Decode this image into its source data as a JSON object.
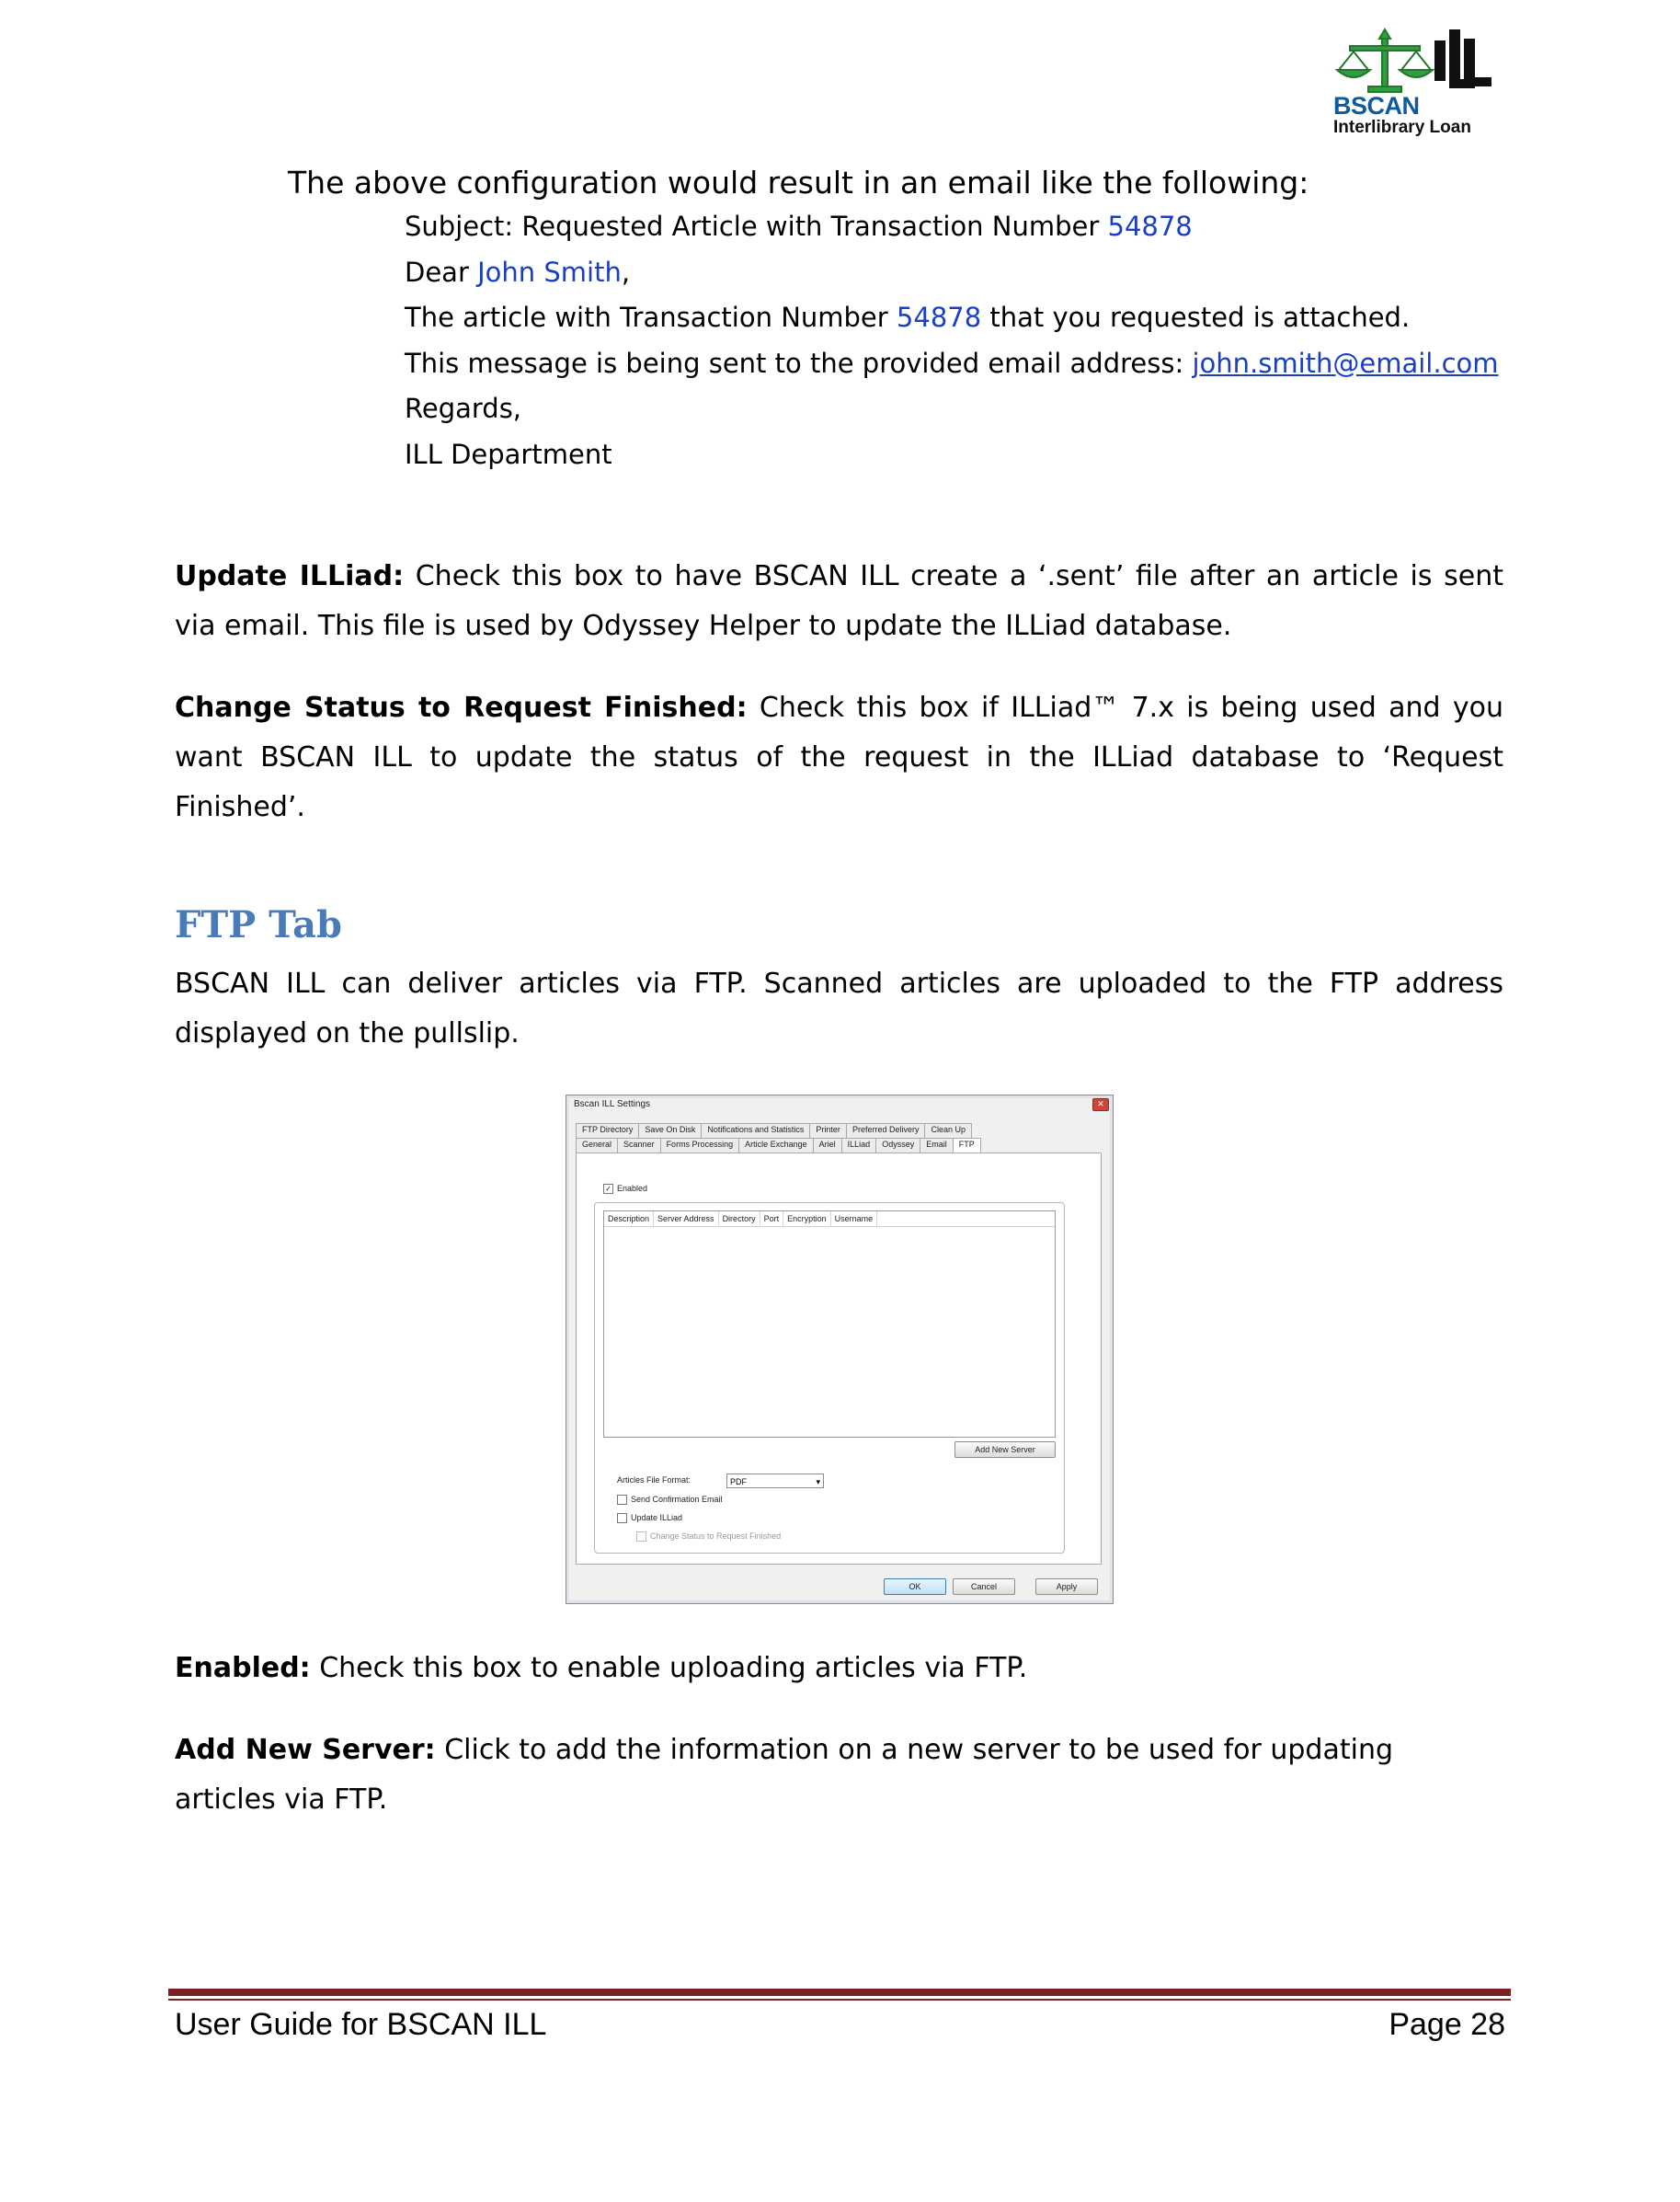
{
  "logo": {
    "name": "BSCAN",
    "subtitle": "Interlibrary Loan"
  },
  "email_example": {
    "intro": "The above configuration would result in an email like the following:",
    "subject_prefix": "Subject: Requested Article with Transaction Number ",
    "transaction_number": "54878",
    "dear_prefix": "Dear ",
    "name": "John Smith",
    "dear_suffix": ",",
    "article_prefix": "The article with Transaction Number ",
    "article_suffix": " that you requested is attached.",
    "message_prefix": "This message is being sent to the provided email address: ",
    "email": "john.smith@email.com",
    "regards": "Regards,",
    "department": "ILL Department"
  },
  "update_illiad": {
    "label": "Update ILLiad:",
    "text": "  Check this box to have BSCAN ILL create a ‘.sent’ file after an article is sent via email.  This file is used by Odyssey Helper to update the ILLiad database."
  },
  "change_status": {
    "label": "Change Status to Request Finished:",
    "text": "  Check this box if ILLiad™ 7.x is being used and you want BSCAN ILL to update the status of the request in the ILLiad database to ‘Request Finished’."
  },
  "ftp_tab": {
    "heading": "FTP Tab",
    "intro": "BSCAN ILL can deliver articles via FTP.  Scanned articles are uploaded to the FTP address displayed on the pullslip."
  },
  "dialog": {
    "title": "Bscan ILL Settings",
    "tabs_row1": [
      "FTP Directory",
      "Save On Disk",
      "Notifications and Statistics",
      "Printer",
      "Preferred Delivery",
      "Clean Up"
    ],
    "tabs_row2": [
      "General",
      "Scanner",
      "Forms Processing",
      "Article Exchange",
      "Ariel",
      "ILLiad",
      "Odyssey",
      "Email",
      "FTP"
    ],
    "enabled_label": "Enabled",
    "columns": [
      "Description",
      "Server Address",
      "Directory",
      "Port",
      "Encryption",
      "Username"
    ],
    "add_server": "Add New Server",
    "format_label": "Articles File Format:",
    "format_value": "PDF",
    "send_confirmation": "Send Confirmation Email",
    "update_illiad": "Update ILLiad",
    "change_status": "Change Status to Request Finished",
    "ok": "OK",
    "cancel": "Cancel",
    "apply": "Apply"
  },
  "enabled_desc": {
    "label": "Enabled:",
    "text": "  Check this box to enable uploading articles via FTP."
  },
  "add_server_desc": {
    "label": "Add New Server:",
    "text": "  Click to add the information on a new server to be used for updating articles via FTP."
  },
  "footer": {
    "left": "User Guide for BSCAN ILL",
    "right": "Page 28"
  },
  "colors": {
    "heading": "#4a7ab8",
    "link": "#1a3fc4",
    "rule": "#7b2122",
    "logo_green": "#2e9e3e"
  }
}
